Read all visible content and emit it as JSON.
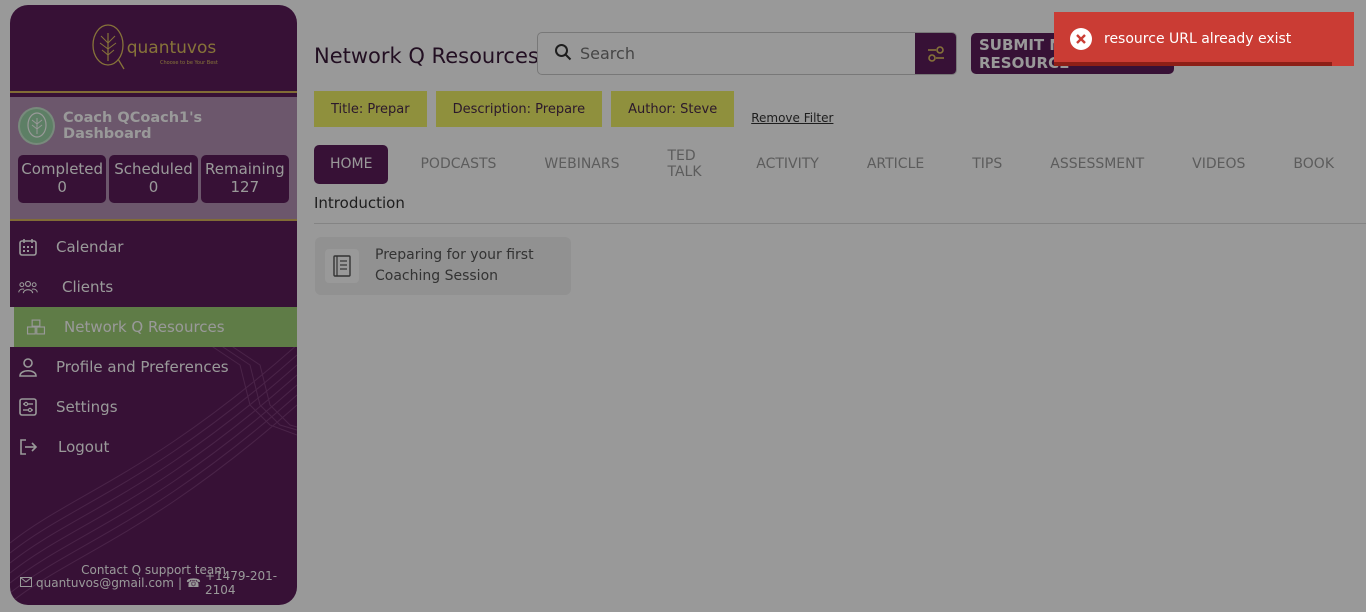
{
  "sidebar": {
    "logo_text": "quantuvos",
    "logo_tagline": "Choose to be Your Best",
    "dashboard_title": "Coach QCoach1's Dashboard",
    "stats": [
      {
        "label": "Completed",
        "value": "0"
      },
      {
        "label": "Scheduled",
        "value": "0"
      },
      {
        "label": "Remaining",
        "value": "127"
      }
    ],
    "nav": [
      {
        "label": "Calendar",
        "icon": "calendar-icon"
      },
      {
        "label": "Clients",
        "icon": "users-icon"
      },
      {
        "label": "Network Q Resources",
        "icon": "boxes-icon",
        "active": true
      },
      {
        "label": "Profile and Preferences",
        "icon": "user-icon"
      },
      {
        "label": "Settings",
        "icon": "settings-icon"
      },
      {
        "label": "Logout",
        "icon": "logout-icon"
      }
    ],
    "contact_title": "Contact Q support team",
    "contact_email": "quantuvos@gmail.com",
    "contact_phone": "+1479-201-2104"
  },
  "main": {
    "page_title": "Network Q Resources",
    "search_placeholder": "Search",
    "submit_button": "SUBMIT NEW RESOURCE",
    "filters": [
      "Title: Prepar",
      "Description: Prepare",
      "Author: Steve"
    ],
    "remove_filter": "Remove Filter",
    "tabs": [
      "HOME",
      "PODCASTS",
      "WEBINARS",
      "TED TALK",
      "ACTIVITY",
      "ARTICLE",
      "TIPS",
      "ASSESSMENT",
      "VIDEOS",
      "BOOK"
    ],
    "active_tab": "HOME",
    "section_label": "Introduction",
    "cards": [
      {
        "title": "Preparing for your first Coaching Session",
        "icon": "book-icon"
      }
    ]
  },
  "toast": {
    "message": "resource URL already exist",
    "type": "error",
    "icon": "error-x-icon"
  },
  "colors": {
    "brand_purple": "#5c1d5b",
    "accent_gold": "#d7b45a",
    "active_green": "#9fcf77",
    "chip_yellow": "#eef066",
    "toast_red": "#ca3c34"
  }
}
